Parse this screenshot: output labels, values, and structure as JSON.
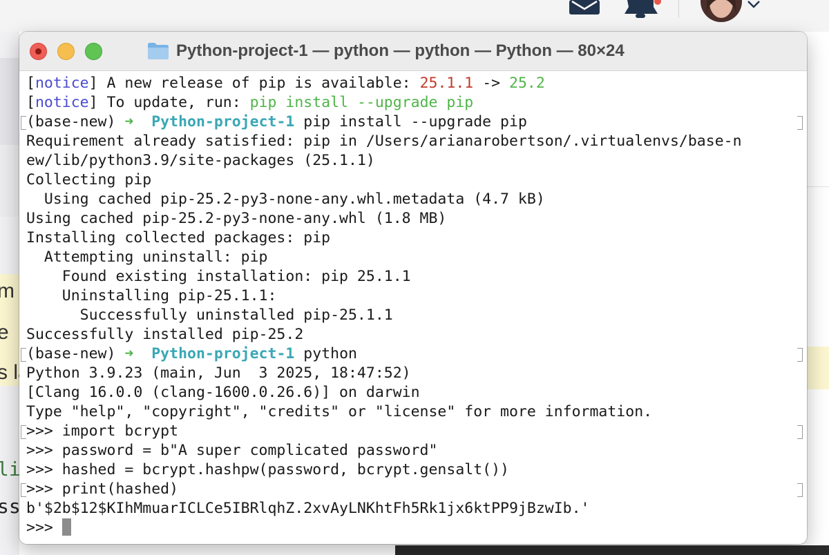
{
  "window": {
    "title": "Python-project-1 — python — python — Python — 80×24"
  },
  "background": {
    "side_text_1": "m",
    "side_text_2": "e",
    "side_text_3": "s la",
    "side_code_1": "li",
    "side_code_2": "ss"
  },
  "terminal": {
    "notice_tag": "notice",
    "notice1_text": " A new release of pip is available: ",
    "notice1_old": "25.1.1",
    "notice1_arrow": " -> ",
    "notice1_new": "25.2",
    "notice2_text": " To update, run: ",
    "notice2_cmd": "pip install --upgrade pip",
    "prompt_env": "(base-new) ",
    "prompt_arrow": "➜",
    "prompt_dir": "Python-project-1",
    "cmd1": " pip install --upgrade pip",
    "cmd2": " python",
    "output_lines": [
      "Requirement already satisfied: pip in /Users/arianarobertson/.virtualenvs/base-n",
      "ew/lib/python3.9/site-packages (25.1.1)",
      "Collecting pip",
      "  Using cached pip-25.2-py3-none-any.whl.metadata (4.7 kB)",
      "Using cached pip-25.2-py3-none-any.whl (1.8 MB)",
      "Installing collected packages: pip",
      "  Attempting uninstall: pip",
      "    Found existing installation: pip 25.1.1",
      "    Uninstalling pip-25.1.1:",
      "      Successfully uninstalled pip-25.1.1",
      "Successfully installed pip-25.2"
    ],
    "python_banner": [
      "Python 3.9.23 (main, Jun  3 2025, 18:47:52)",
      "[Clang 16.0.0 (clang-1600.0.26.6)] on darwin",
      "Type \"help\", \"copyright\", \"credits\" or \"license\" for more information."
    ],
    "repl_lines": [
      ">>> import bcrypt",
      ">>> password = b\"A super complicated password\"",
      ">>> hashed = bcrypt.hashpw(password, bcrypt.gensalt())",
      ">>> print(hashed)",
      "b'$2b$12$KIhMmuarICLCe5IBRlqhZ.2xvAyLNKhtFh5Rk1jx6ktPP9jBzwIb.'"
    ],
    "repl_prompt": ">>> "
  },
  "colors": {
    "notice": "#4b4bd0",
    "version_old": "#c23a2e",
    "version_new": "#4fb548",
    "prompt_dir": "#3aa7b5",
    "prompt_arrow": "#4fb548"
  }
}
